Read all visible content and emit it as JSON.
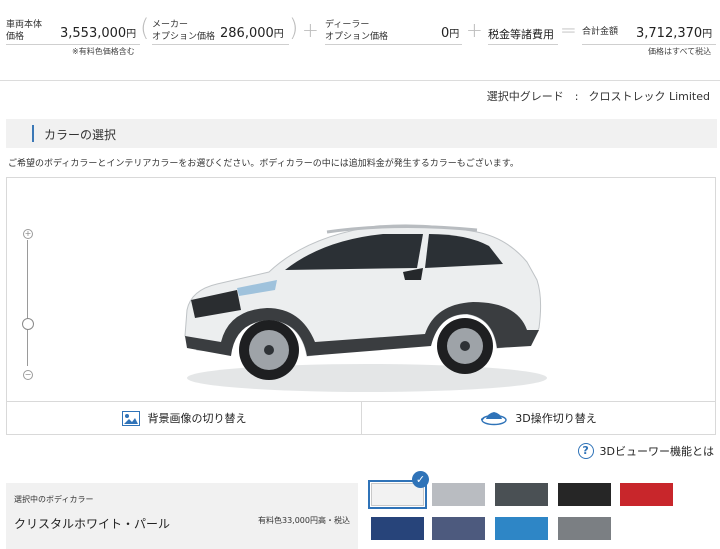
{
  "price": {
    "body": {
      "label1": "車両本体",
      "label2": "価格",
      "value": "3,553,000",
      "unit": "円"
    },
    "maker_option": {
      "label1": "メーカー",
      "label2": "オプション価格",
      "value": "286,000",
      "unit": "円"
    },
    "dealer_option": {
      "label1": "ディーラー",
      "label2": "オプション価格",
      "value": "0",
      "unit": "円"
    },
    "tax_label": "税金等諸費用",
    "total": {
      "label": "合計金額",
      "value": "3,712,370",
      "unit": "円"
    },
    "note_body": "※有料色価格含む",
    "note_total": "価格はすべて税込",
    "plus": "+",
    "equals": "="
  },
  "grade": {
    "label": "選択中グレード　:",
    "name": "クロストレック Limited"
  },
  "section": {
    "title": "カラーの選択"
  },
  "description": "ご希望のボディカラーとインテリアカラーをお選びください。ボディカラーの中には追加料金が発生するカラーもございます。",
  "viewer": {
    "zoom_level": 0.33,
    "bg_button": "背景画像の切り替え",
    "op_button": "3D操作切り替え"
  },
  "help": {
    "label": "3Dビューワー機能とは"
  },
  "body_color": {
    "label": "選択中のボディカラー",
    "name": "クリスタルホワイト・パール",
    "note": "有料色33,000円高・税込"
  },
  "swatches": [
    "#f2f2f2",
    "#b9bcc1",
    "#4a5054",
    "#262626",
    "#c8262b",
    "#27447a",
    "#4d5a7e",
    "#2e86c6",
    "#7b7f83"
  ],
  "colors": {
    "accent": "#2f73b8",
    "section_bar": "#3b78b6",
    "car_body": "#eceeef"
  }
}
